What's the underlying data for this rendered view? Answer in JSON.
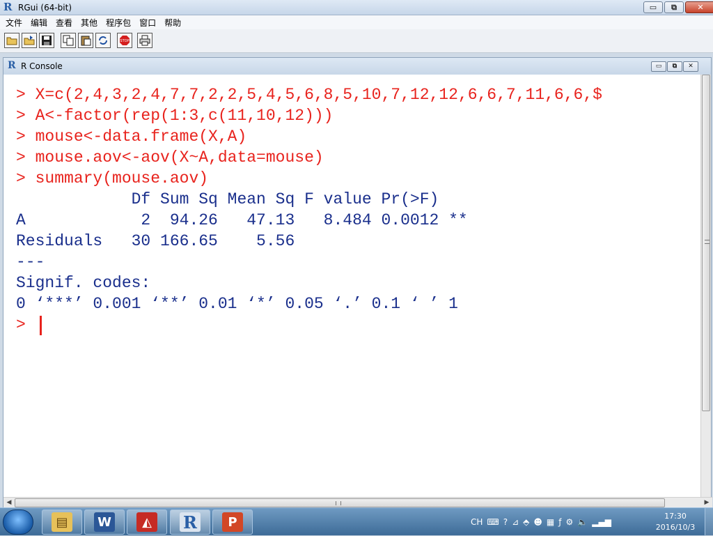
{
  "window": {
    "title": "RGui (64-bit)",
    "buttons": {
      "minimize": "▭",
      "maximize": "⧉",
      "close": "✕"
    }
  },
  "menu": [
    "文件",
    "编辑",
    "查看",
    "其他",
    "程序包",
    "窗口",
    "帮助"
  ],
  "toolbar": {
    "icons": [
      "open-script-icon",
      "load-workspace-icon",
      "save-workspace-icon",
      "copy-icon",
      "paste-icon",
      "copy-paste-icon",
      "stop-icon",
      "print-icon"
    ],
    "stop_label": "STOP"
  },
  "console": {
    "title": "R Console",
    "lines": [
      {
        "text": "> X=c(2,4,3,2,4,7,7,2,2,5,4,5,6,8,5,10,7,12,12,6,6,7,11,6,6,$",
        "kind": "cmd"
      },
      {
        "text": "> A<-factor(rep(1:3,c(11,10,12)))",
        "kind": "cmd"
      },
      {
        "text": "> mouse<-data.frame(X,A)",
        "kind": "cmd"
      },
      {
        "text": "> mouse.aov<-aov(X~A,data=mouse)",
        "kind": "cmd"
      },
      {
        "text": "> summary(mouse.aov)",
        "kind": "cmd"
      },
      {
        "text": "            Df Sum Sq Mean Sq F value Pr(>F)  ",
        "kind": "out"
      },
      {
        "text": "A            2  94.26   47.13   8.484 0.0012 **",
        "kind": "out"
      },
      {
        "text": "Residuals   30 166.65    5.56                 ",
        "kind": "out"
      },
      {
        "text": "---",
        "kind": "out"
      },
      {
        "text": "Signif. codes:",
        "kind": "out"
      },
      {
        "text": "0 ‘***’ 0.001 ‘**’ 0.01 ‘*’ 0.05 ‘.’ 0.1 ‘ ’ 1",
        "kind": "out"
      },
      {
        "text": "> ",
        "kind": "cmd"
      }
    ],
    "hscroll_grip": "III",
    "vscroll_grip": "≡"
  },
  "taskbar": {
    "apps": [
      {
        "name": "explorer",
        "glyph": "▤",
        "color": "#e7c15a"
      },
      {
        "name": "word",
        "glyph": "W",
        "color": "#2b5797"
      },
      {
        "name": "adobe",
        "glyph": "◭",
        "color": "#c62b24"
      },
      {
        "name": "r",
        "glyph": "R",
        "color": "#2a5fa6"
      },
      {
        "name": "powerpoint",
        "glyph": "P",
        "color": "#d24726"
      }
    ],
    "tray_lang": "CH",
    "clock_time": "17:30",
    "clock_date": "2016/10/3"
  },
  "colors": {
    "command": "#e8231d",
    "output": "#1a2f8c"
  }
}
